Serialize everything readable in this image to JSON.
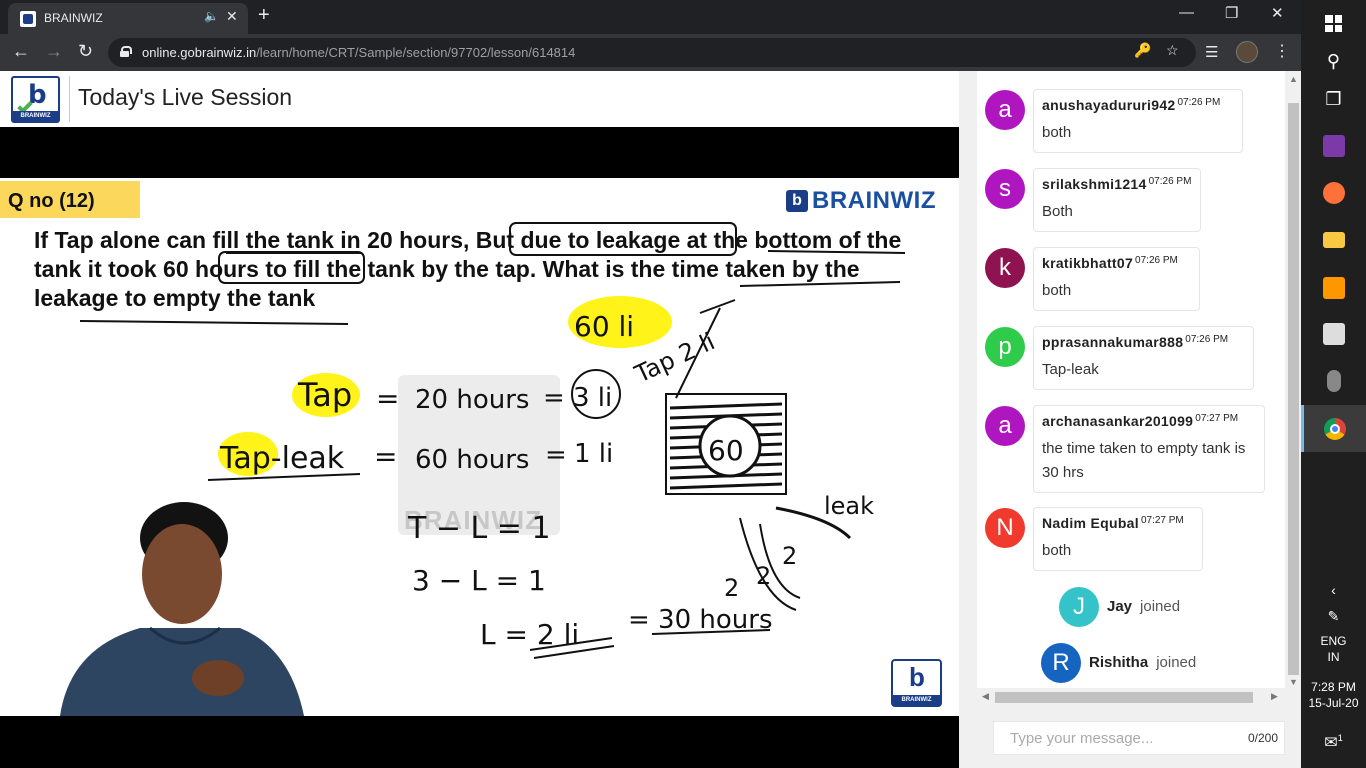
{
  "browser": {
    "tab_title": "BRAINWIZ",
    "url_host": "online.gobrainwiz.in",
    "url_path": "/learn/home/CRT/Sample/section/97702/lesson/614814"
  },
  "header": {
    "title": "Today's Live Session",
    "logo_text": "BRAINWIZ"
  },
  "slide": {
    "question_no": "Q no (12)",
    "brand": "BRAINWIZ",
    "question_text": "If Tap alone can fill the tank in 20 hours, But due to leakage at the bottom of the tank it took 60 hours to fill the tank by the tap. What is the time taken by the leakage to empty the tank",
    "watermark": "BRAINWIZ",
    "handwriting": {
      "total": "60 li",
      "tap_label": "Tap",
      "tap_hours": "20 hours",
      "tap_rate": "3 li",
      "tap_leak_label": "Tap-leak",
      "tap_leak_hours": "60 hours",
      "tap_leak_rate": "1 li",
      "step1": "T − L = 1",
      "step2": "3 − L = 1",
      "step3a": "L = 2 li",
      "step3b": "= 30 hours",
      "tap2": "Tap 2 li",
      "tank": "60",
      "leak": "leak",
      "leak_rate": "2",
      "leak_rate2": "2",
      "leak_rate3": "2"
    }
  },
  "chat": {
    "messages": [
      {
        "initial": "a",
        "color": "#b016c0",
        "user": "anushayadururi942",
        "time": "07:26 PM",
        "text": "both"
      },
      {
        "initial": "s",
        "color": "#b016c0",
        "user": "srilakshmi1214",
        "time": "07:26 PM",
        "text": "Both"
      },
      {
        "initial": "k",
        "color": "#8e1350",
        "user": "kratikbhatt07",
        "time": "07:26 PM",
        "text": "both"
      },
      {
        "initial": "p",
        "color": "#2ecc4a",
        "user": "pprasannakumar888",
        "time": "07:26 PM",
        "text": "Tap-leak"
      },
      {
        "initial": "a",
        "color": "#b016c0",
        "user": "archanasankar201099",
        "time": "07:27 PM",
        "text": "the time taken to empty tank is 30 hrs"
      },
      {
        "initial": "N",
        "color": "#f03a2e",
        "user": "Nadim Equbal",
        "time": "07:27 PM",
        "text": "both"
      }
    ],
    "joins": [
      {
        "initial": "J",
        "color": "#33c3c9",
        "name": "Jay",
        "word": "joined"
      },
      {
        "initial": "R",
        "color": "#1565c0",
        "name": "Rishitha",
        "word": "joined"
      }
    ],
    "input_placeholder": "Type your message...",
    "char_count": "0/200"
  },
  "taskbar": {
    "lang1": "ENG",
    "lang2": "IN",
    "time": "7:28 PM",
    "date": "15-Jul-20",
    "notif_count": "1"
  }
}
